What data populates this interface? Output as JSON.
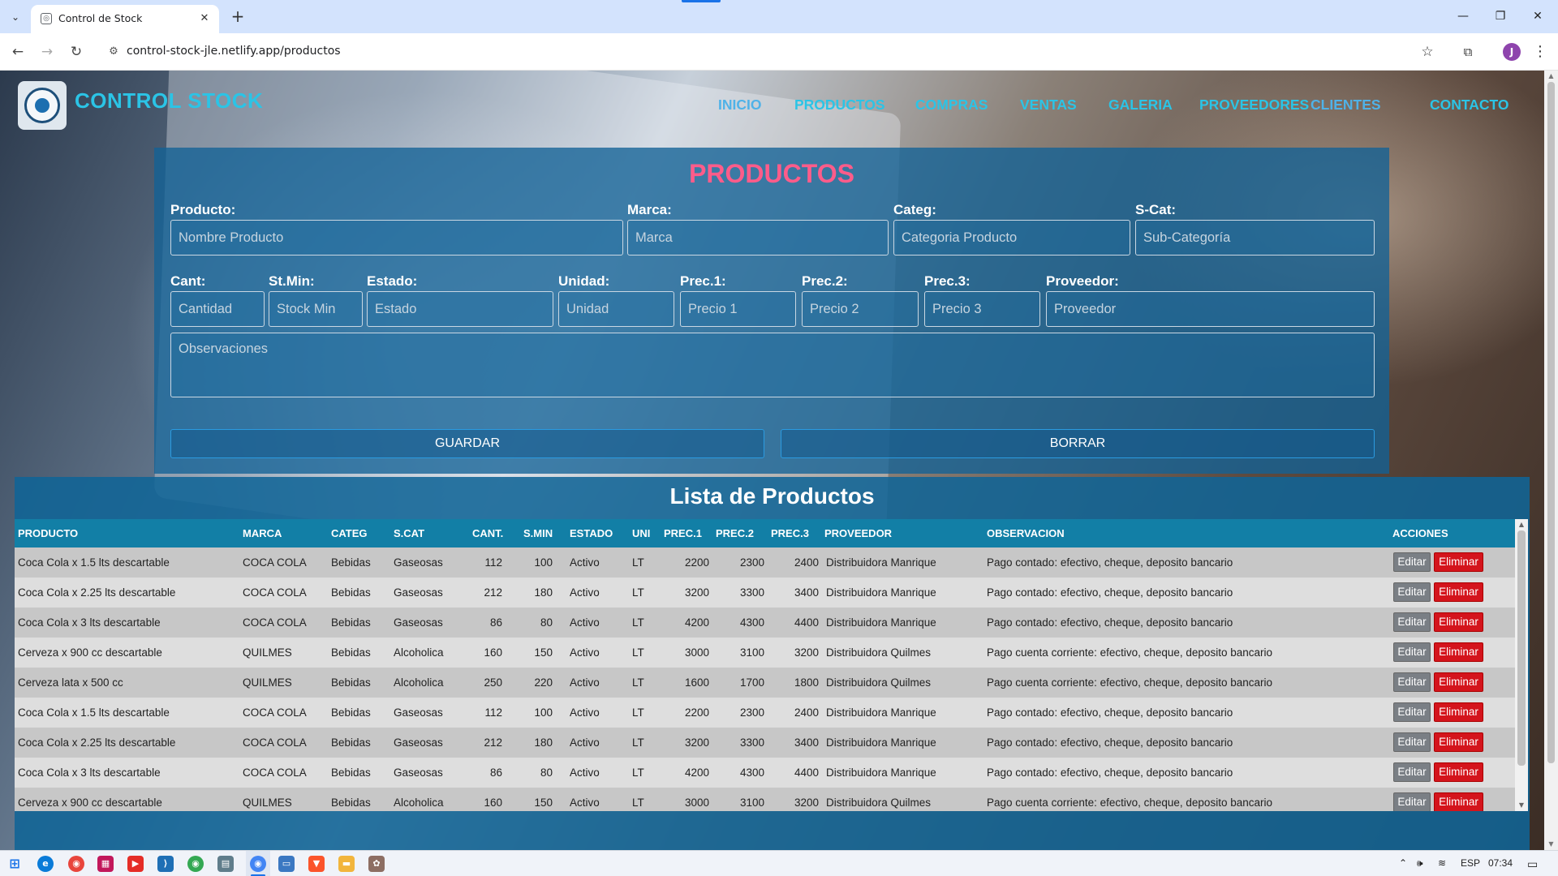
{
  "browser": {
    "tab_title": "Control de Stock",
    "url": "control-stock-jle.netlify.app/productos",
    "profile_initial": "J"
  },
  "header": {
    "brand": "CONTROL STOCK",
    "nav": [
      "INICIO",
      "PRODUCTOS",
      "COMPRAS",
      "VENTAS",
      "GALERIA",
      "PROVEEDORES",
      "CLIENTES",
      "CONTACTO"
    ]
  },
  "form": {
    "title": "PRODUCTOS",
    "fields": {
      "producto": {
        "label": "Producto:",
        "placeholder": "Nombre Producto"
      },
      "marca": {
        "label": "Marca:",
        "placeholder": "Marca"
      },
      "categ": {
        "label": "Categ:",
        "placeholder": "Categoria Producto"
      },
      "scat": {
        "label": "S-Cat:",
        "placeholder": "Sub-Categoría"
      },
      "cant": {
        "label": "Cant:",
        "placeholder": "Cantidad"
      },
      "stmin": {
        "label": "St.Min:",
        "placeholder": "Stock Min"
      },
      "estado": {
        "label": "Estado:",
        "placeholder": "Estado"
      },
      "unidad": {
        "label": "Unidad:",
        "placeholder": "Unidad"
      },
      "prec1": {
        "label": "Prec.1:",
        "placeholder": "Precio 1"
      },
      "prec2": {
        "label": "Prec.2:",
        "placeholder": "Precio 2"
      },
      "prec3": {
        "label": "Prec.3:",
        "placeholder": "Precio 3"
      },
      "proveedor": {
        "label": "Proveedor:",
        "placeholder": "Proveedor"
      },
      "observaciones": {
        "placeholder": "Observaciones"
      }
    },
    "save_label": "GUARDAR",
    "clear_label": "BORRAR"
  },
  "list": {
    "title": "Lista de Productos",
    "columns": [
      "PRODUCTO",
      "MARCA",
      "CATEG",
      "S.CAT",
      "CANT.",
      "S.MIN",
      "ESTADO",
      "UNI",
      "PREC.1",
      "PREC.2",
      "PREC.3",
      "PROVEEDOR",
      "OBSERVACION",
      "ACCIONES"
    ],
    "edit_label": "Editar",
    "delete_label": "Eliminar",
    "rows": [
      [
        "Coca Cola x 1.5 lts descartable",
        "COCA COLA",
        "Bebidas",
        "Gaseosas",
        "112",
        "100",
        "Activo",
        "LT",
        "2200",
        "2300",
        "2400",
        "Distribuidora Manrique",
        "Pago contado: efectivo, cheque, deposito bancario"
      ],
      [
        "Coca Cola x 2.25 lts descartable",
        "COCA COLA",
        "Bebidas",
        "Gaseosas",
        "212",
        "180",
        "Activo",
        "LT",
        "3200",
        "3300",
        "3400",
        "Distribuidora Manrique",
        "Pago contado: efectivo, cheque, deposito bancario"
      ],
      [
        "Coca Cola x 3 lts descartable",
        "COCA COLA",
        "Bebidas",
        "Gaseosas",
        "86",
        "80",
        "Activo",
        "LT",
        "4200",
        "4300",
        "4400",
        "Distribuidora Manrique",
        "Pago contado: efectivo, cheque, deposito bancario"
      ],
      [
        "Cerveza x 900 cc descartable",
        "QUILMES",
        "Bebidas",
        "Alcoholica",
        "160",
        "150",
        "Activo",
        "LT",
        "3000",
        "3100",
        "3200",
        "Distribuidora Quilmes",
        "Pago cuenta corriente: efectivo, cheque, deposito bancario"
      ],
      [
        "Cerveza lata x 500 cc",
        "QUILMES",
        "Bebidas",
        "Alcoholica",
        "250",
        "220",
        "Activo",
        "LT",
        "1600",
        "1700",
        "1800",
        "Distribuidora Quilmes",
        "Pago cuenta corriente: efectivo, cheque, deposito bancario"
      ],
      [
        "Coca Cola x 1.5 lts descartable",
        "COCA COLA",
        "Bebidas",
        "Gaseosas",
        "112",
        "100",
        "Activo",
        "LT",
        "2200",
        "2300",
        "2400",
        "Distribuidora Manrique",
        "Pago contado: efectivo, cheque, deposito bancario"
      ],
      [
        "Coca Cola x 2.25 lts descartable",
        "COCA COLA",
        "Bebidas",
        "Gaseosas",
        "212",
        "180",
        "Activo",
        "LT",
        "3200",
        "3300",
        "3400",
        "Distribuidora Manrique",
        "Pago contado: efectivo, cheque, deposito bancario"
      ],
      [
        "Coca Cola x 3 lts descartable",
        "COCA COLA",
        "Bebidas",
        "Gaseosas",
        "86",
        "80",
        "Activo",
        "LT",
        "4200",
        "4300",
        "4400",
        "Distribuidora Manrique",
        "Pago contado: efectivo, cheque, deposito bancario"
      ],
      [
        "Cerveza x 900 cc descartable",
        "QUILMES",
        "Bebidas",
        "Alcoholica",
        "160",
        "150",
        "Activo",
        "LT",
        "3000",
        "3100",
        "3200",
        "Distribuidora Quilmes",
        "Pago cuenta corriente: efectivo, cheque, deposito bancario"
      ]
    ]
  },
  "taskbar": {
    "language": "ESP",
    "time": "07:34"
  },
  "colors": {
    "accent": "#2bc4e6",
    "title_pink": "#ff5c8a",
    "delete_red": "#d4141c",
    "edit_gray": "#7a7f85"
  }
}
